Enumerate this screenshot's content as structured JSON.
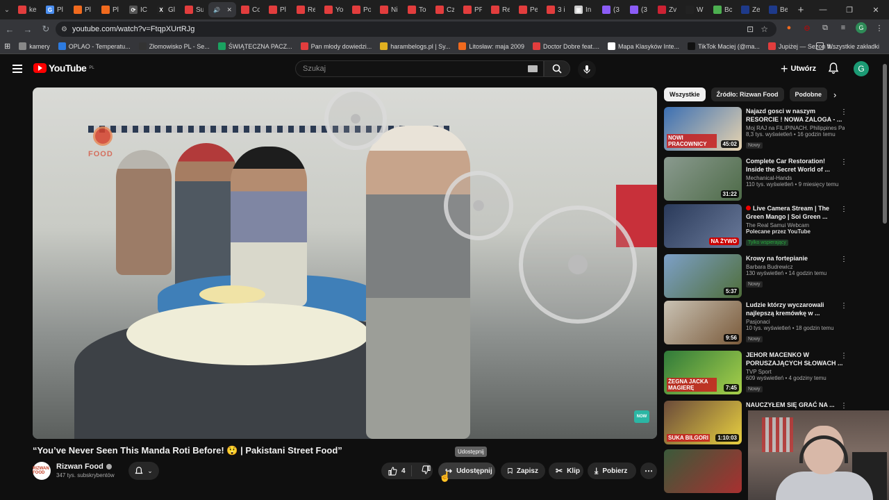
{
  "browser": {
    "tabs": [
      {
        "title": "ke",
        "color": "#e23d3d",
        "glyph": ""
      },
      {
        "title": "Pl",
        "color": "#4a8ef0",
        "glyph": "G"
      },
      {
        "title": "Pl",
        "color": "#f06a1e",
        "glyph": ""
      },
      {
        "title": "Pl",
        "color": "#f06a1e",
        "glyph": ""
      },
      {
        "title": "IC",
        "color": "#555555",
        "glyph": "⟳"
      },
      {
        "title": "Gl",
        "color": "#222222",
        "glyph": "X"
      },
      {
        "title": "Su",
        "color": "#e23d3d",
        "glyph": ""
      },
      {
        "title": "",
        "color": "#35363a",
        "glyph": "🔊"
      },
      {
        "title": "Co",
        "color": "#e23d3d",
        "glyph": ""
      },
      {
        "title": "Pl",
        "color": "#e23d3d",
        "glyph": ""
      },
      {
        "title": "Re",
        "color": "#e23d3d",
        "glyph": ""
      },
      {
        "title": "Yo",
        "color": "#e23d3d",
        "glyph": ""
      },
      {
        "title": "Po",
        "color": "#e23d3d",
        "glyph": ""
      },
      {
        "title": "Ni",
        "color": "#e23d3d",
        "glyph": ""
      },
      {
        "title": "To",
        "color": "#e23d3d",
        "glyph": ""
      },
      {
        "title": "Cz",
        "color": "#e23d3d",
        "glyph": ""
      },
      {
        "title": "PF",
        "color": "#e23d3d",
        "glyph": ""
      },
      {
        "title": "Re",
        "color": "#e23d3d",
        "glyph": ""
      },
      {
        "title": "Pe",
        "color": "#e23d3d",
        "glyph": ""
      },
      {
        "title": "3 i",
        "color": "#e23d3d",
        "glyph": ""
      },
      {
        "title": "In",
        "color": "#cccccc",
        "glyph": "▥"
      },
      {
        "title": "(3",
        "color": "#8b5cf6",
        "glyph": ""
      },
      {
        "title": "(3",
        "color": "#8b5cf6",
        "glyph": ""
      },
      {
        "title": "Zv",
        "color": "#cc2233",
        "glyph": ""
      },
      {
        "title": "W",
        "color": "#222222",
        "glyph": ""
      },
      {
        "title": "Bc",
        "color": "#4caf50",
        "glyph": ""
      },
      {
        "title": "Ze",
        "color": "#1e3a8a",
        "glyph": ""
      },
      {
        "title": "Be",
        "color": "#1e3a8a",
        "glyph": ""
      }
    ],
    "active_tab_index": 7,
    "url": "youtube.com/watch?v=FtqpXUrtRJg",
    "bookmarks": [
      {
        "label": "kamery",
        "color": "#888888"
      },
      {
        "label": "OPLAO - Temperatu...",
        "color": "#2d7be0"
      },
      {
        "label": "Złomowisko PL - Se...",
        "color": "#333333"
      },
      {
        "label": "ŚWIĄTECZNA PACZ...",
        "color": "#1aa260"
      },
      {
        "label": "Pan młody dowiedzi...",
        "color": "#e23d3d"
      },
      {
        "label": "harambelogs.pl | Sy...",
        "color": "#e0b020"
      },
      {
        "label": "Litosław: maja 2009",
        "color": "#f06a1e"
      },
      {
        "label": "Doctor Dobre feat....",
        "color": "#e23d3d"
      },
      {
        "label": "Mapa Klasyków Inte...",
        "color": "#ffffff"
      },
      {
        "label": "TikTok Maciej (@ma...",
        "color": "#111111"
      },
      {
        "label": "Jupiżej — Sezon ft....",
        "color": "#e23d3d"
      }
    ],
    "all_bookmarks": "Wszystkie zakładki",
    "profile_letter": "G"
  },
  "youtube": {
    "logo_text": "YouTube",
    "logo_region": "PL",
    "search_placeholder": "Szukaj",
    "create_label": "Utwórz",
    "avatar_letter": "G"
  },
  "video": {
    "title": "“You’ve Never Seen This Manda Roti Before! 😲 | Pakistani Street Food”",
    "watermark": "FOOD",
    "now_badge": "NOW",
    "channel": {
      "name": "Rizwan Food",
      "subscribers": "347 tys. subskrybentów",
      "avatar_text": "RIZWAN FOOD"
    },
    "actions": {
      "likes": "4",
      "share": "Udostępnij",
      "save": "Zapisz",
      "clip": "Klip",
      "download": "Pobierz"
    },
    "tooltip": "Udostępnij"
  },
  "sidebar": {
    "chips": [
      "Wszystkie",
      "Źródło: Rizwan Food",
      "Podobne"
    ],
    "items": [
      {
        "title": "Najazd gosci w naszym RESORCIE ! NOWA ZALOGA - ...",
        "channel": "Moj RAJ na FILIPINACH. Philippines Par...",
        "meta": "8,3 tys. wyświetleń • 16 godzin temu",
        "badge": "Nowy",
        "duration": "45:02",
        "thumb_a": "#3b6fb2",
        "thumb_b": "#e8d4b0",
        "thumb_text": "NOWI PRACOWNICY"
      },
      {
        "title": "Complete Car Restoration! Inside the Secret World of ...",
        "channel": "Mechanical-Hands",
        "meta": "110 tys. wyświetleń • 9 miesięcy temu",
        "badge": "",
        "duration": "31:22",
        "thumb_a": "#8a9a8f",
        "thumb_b": "#4e6b48",
        "thumb_text": ""
      },
      {
        "title": "Live Camera Stream | The Green Mango | Soi Green ...",
        "channel": "The Real Samui Webcam",
        "meta": "",
        "promo": "Polecane przez YouTube",
        "members": "Tylko wspierający",
        "badge": "",
        "duration": "NA ŻYWO",
        "live": true,
        "thumb_a": "#2a3a5a",
        "thumb_b": "#6a7a9a",
        "thumb_text": ""
      },
      {
        "title": "Krowy na fortepianie",
        "channel": "Barbara Budrewicz",
        "meta": "130 wyświetleń • 14 godzin temu",
        "badge": "Nowy",
        "duration": "5:37",
        "thumb_a": "#7da0c8",
        "thumb_b": "#4f6e3a",
        "thumb_text": ""
      },
      {
        "title": "Ludzie którzy wyczarowali najlepszą kremówkę w ...",
        "channel": "Pasjonaci",
        "meta": "10 tys. wyświetleń • 18 godzin temu",
        "badge": "Nowy",
        "duration": "9:56",
        "thumb_a": "#c9c2b4",
        "thumb_b": "#7a5a3a",
        "thumb_text": ""
      },
      {
        "title": "JEHOR MACENKO W PORUSZAJĄCYCH SŁOWACH ...",
        "channel": "TVP Sport",
        "meta": "609 wyświetleń • 4 godziny temu",
        "badge": "Nowy",
        "duration": "7:45",
        "thumb_a": "#2f7a3a",
        "thumb_b": "#a8d04a",
        "thumb_text": "ŻEGNA JACKA MAGIERĘ"
      },
      {
        "title": "NAUCZYŁEM SIĘ GRAĆ NA ...",
        "channel": "",
        "meta": "",
        "badge": "",
        "duration": "1:10:03",
        "thumb_a": "#6a4a3a",
        "thumb_b": "#e8d040",
        "thumb_text": "SUKA BILGORI"
      },
      {
        "title": "",
        "channel": "",
        "meta": "",
        "badge": "",
        "duration": "",
        "thumb_a": "#3a5a3a",
        "thumb_b": "#a83030",
        "thumb_text": ""
      }
    ]
  }
}
